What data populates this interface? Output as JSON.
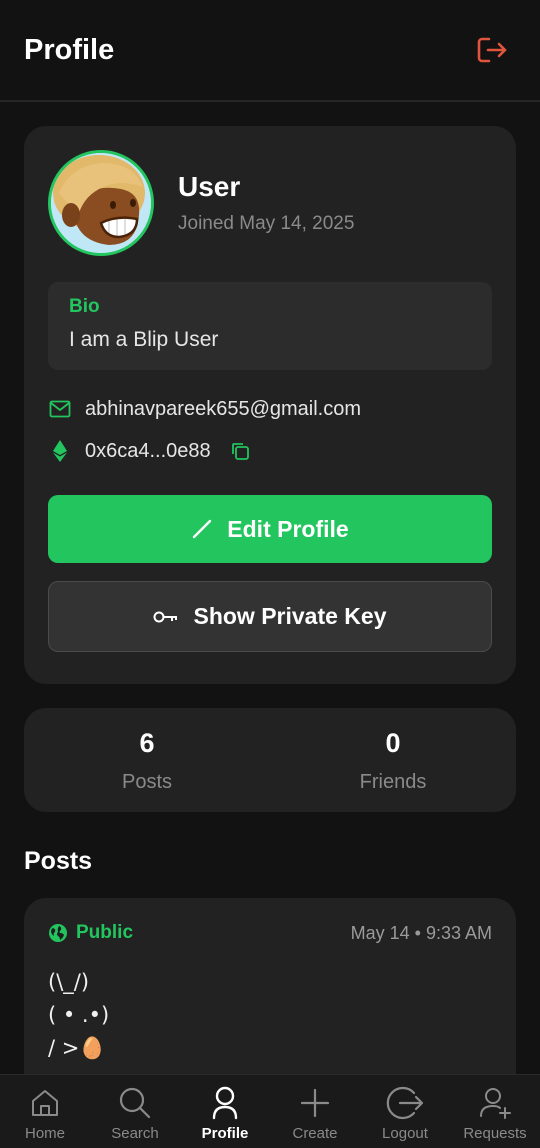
{
  "header": {
    "title": "Profile"
  },
  "profile": {
    "name": "User",
    "joined": "Joined May 14, 2025",
    "bio_label": "Bio",
    "bio": "I am a Blip User",
    "email": "abhinavpareek655@gmail.com",
    "wallet": "0x6ca4...0e88",
    "edit_label": "Edit Profile",
    "private_key_label": "Show Private Key"
  },
  "stats": [
    {
      "value": "6",
      "label": "Posts"
    },
    {
      "value": "0",
      "label": "Friends"
    }
  ],
  "posts_heading": "Posts",
  "posts": [
    {
      "visibility": "Public",
      "time": "May 14 • 9:33 AM",
      "body": "(\\_/)\n( • .•)\n/ >🥚"
    }
  ],
  "tabs": [
    {
      "label": "Home",
      "icon": "home-icon"
    },
    {
      "label": "Search",
      "icon": "search-icon"
    },
    {
      "label": "Profile",
      "icon": "user-icon"
    },
    {
      "label": "Create",
      "icon": "plus-icon"
    },
    {
      "label": "Logout",
      "icon": "logout-icon"
    },
    {
      "label": "Requests",
      "icon": "user-add-icon"
    }
  ],
  "colors": {
    "accent": "#22c55e",
    "logout": "#e0553d",
    "background": "#121212",
    "card": "#222222"
  }
}
